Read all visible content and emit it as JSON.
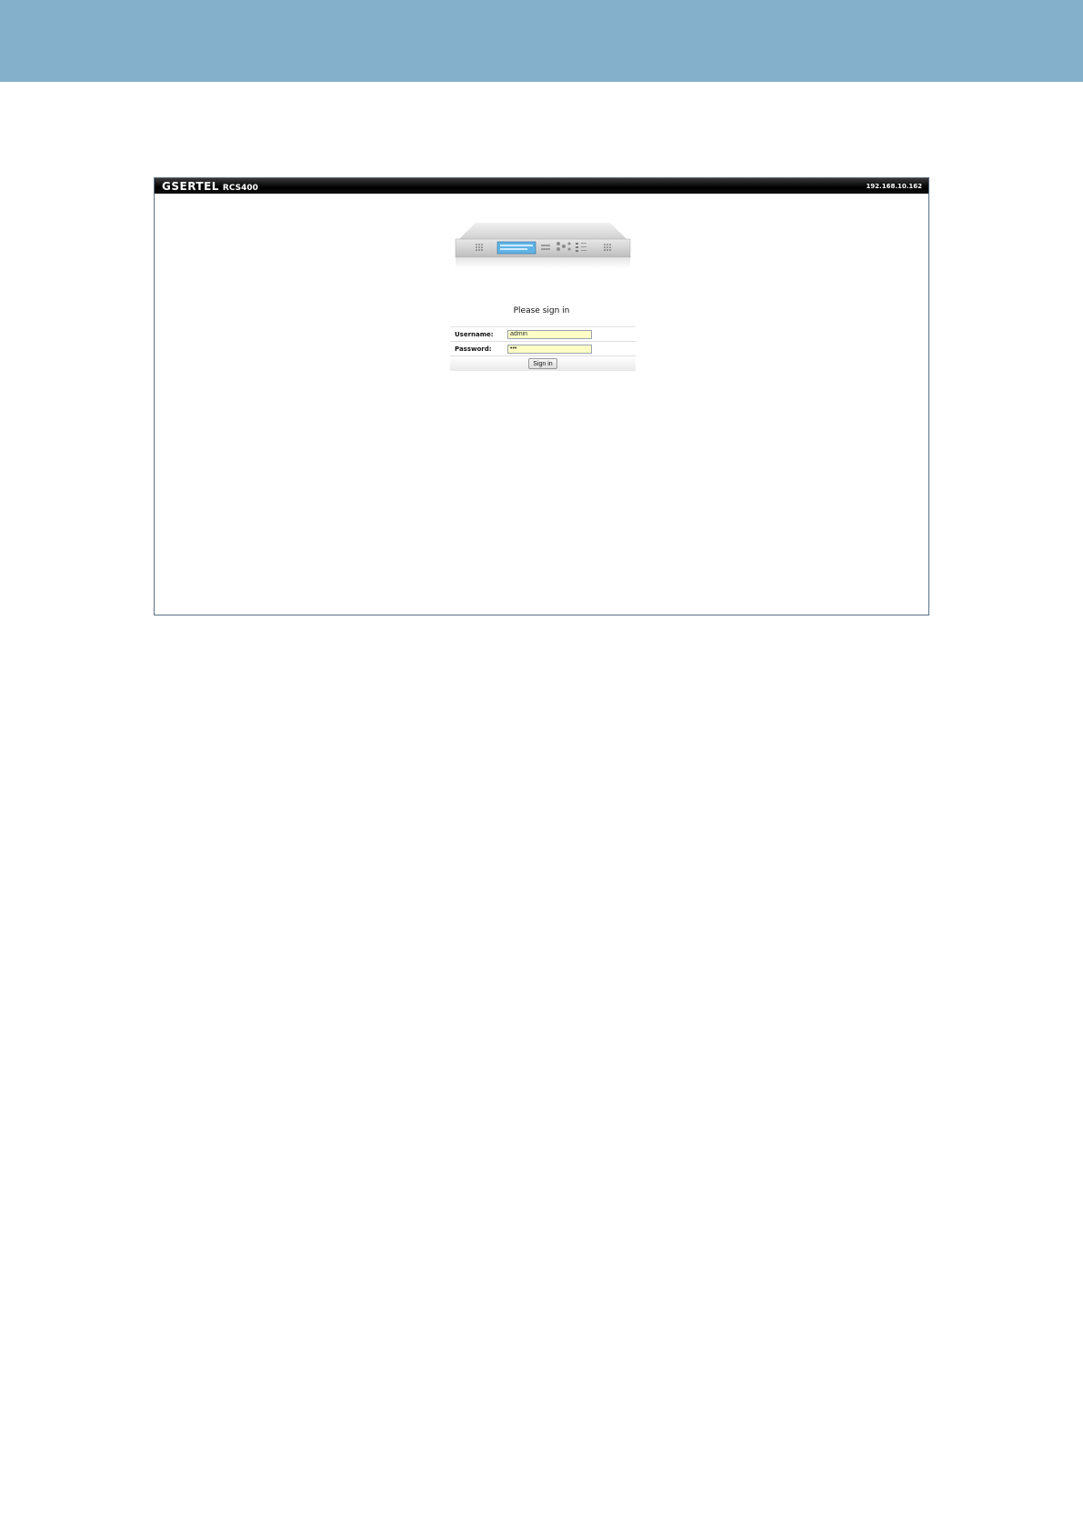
{
  "header": {
    "brand": "GSERTEL",
    "model": "RCS400",
    "ip_address": "192.168.10.162"
  },
  "login": {
    "title": "Please sign in",
    "username_label": "Username:",
    "username_value": "admin",
    "password_label": "Password:",
    "password_value": "•••",
    "signin_button": "Sign in"
  },
  "colors": {
    "top_band": "#84b0cb",
    "header_bar": "#000000",
    "input_background": "#ffffc6",
    "frame_border": "#5a6f86"
  }
}
